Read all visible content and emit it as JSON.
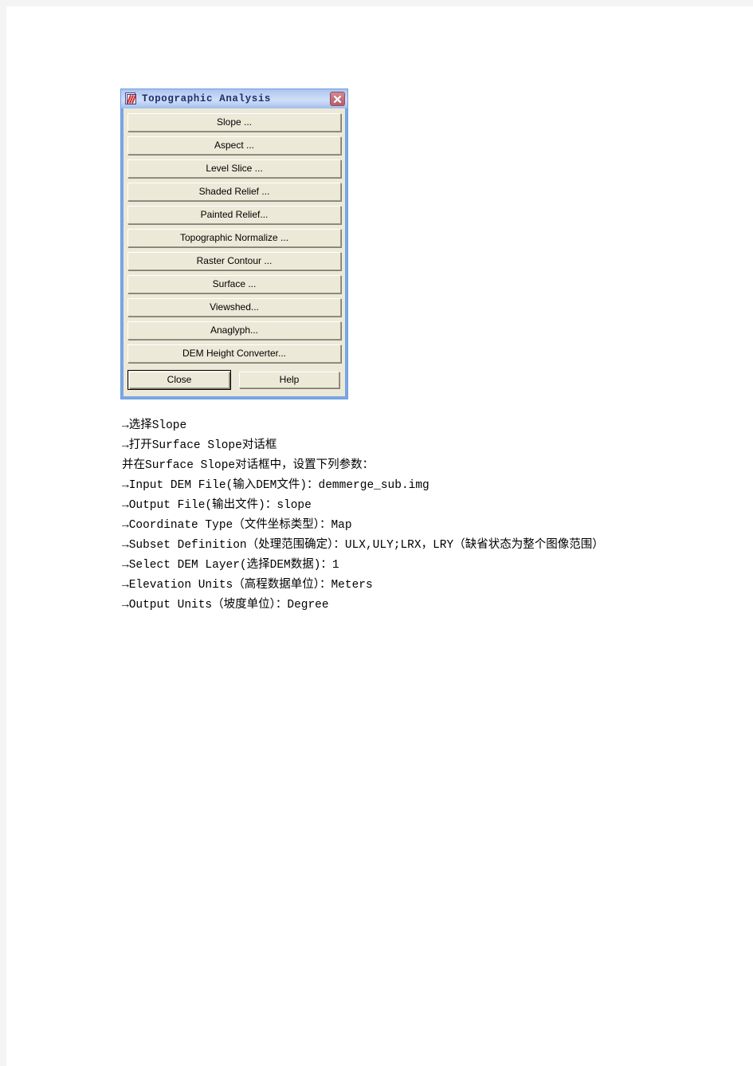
{
  "dialog": {
    "title": "Topographic Analysis",
    "title_icon": "topographic-analysis-icon",
    "close_icon": "close-icon",
    "buttons": [
      {
        "label": "Slope ...",
        "name": "slope"
      },
      {
        "label": "Aspect ...",
        "name": "aspect"
      },
      {
        "label": "Level Slice ...",
        "name": "level-slice"
      },
      {
        "label": "Shaded Relief ...",
        "name": "shaded-relief"
      },
      {
        "label": "Painted Relief...",
        "name": "painted-relief"
      },
      {
        "label": "Topographic Normalize ...",
        "name": "topographic-normalize"
      },
      {
        "label": "Raster Contour ...",
        "name": "raster-contour"
      },
      {
        "label": "Surface ...",
        "name": "surface"
      },
      {
        "label": "Viewshed...",
        "name": "viewshed"
      },
      {
        "label": "Anaglyph...",
        "name": "anaglyph"
      },
      {
        "label": "DEM Height Converter...",
        "name": "dem-height-converter"
      }
    ],
    "close_label": "Close",
    "help_label": "Help",
    "colors": {
      "titlebar_blue": "#b8cdf2",
      "frame_blue": "#7ba6e5",
      "button_face": "#ece9d8",
      "close_red": "#c5737f",
      "title_text": "#1d2f6b"
    }
  },
  "notes": {
    "lines": [
      "→选择Slope",
      "→打开Surface Slope对话框",
      "并在Surface Slope对话框中，设置下列参数：",
      "→Input DEM File(输入DEM文件)：demmerge_sub.img",
      "→Output File(输出文件)：slope",
      "→Coordinate Type（文件坐标类型）：Map",
      "→Subset Definition（处理范围确定）：ULX,ULY;LRX，LRY（缺省状态为整个图像范围）",
      "→Select DEM Layer(选择DEM数据)：1",
      "→Elevation Units（高程数据单位）：Meters",
      "→Output Units（坡度单位）：Degree"
    ]
  }
}
